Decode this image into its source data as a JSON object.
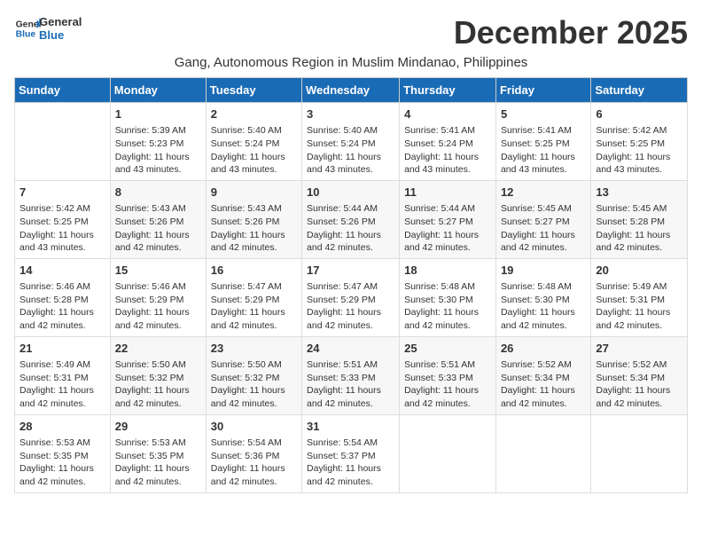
{
  "header": {
    "logo_line1": "General",
    "logo_line2": "Blue",
    "month_title": "December 2025",
    "subtitle": "Gang, Autonomous Region in Muslim Mindanao, Philippines"
  },
  "days_of_week": [
    "Sunday",
    "Monday",
    "Tuesday",
    "Wednesday",
    "Thursday",
    "Friday",
    "Saturday"
  ],
  "weeks": [
    [
      {
        "day": "",
        "info": ""
      },
      {
        "day": "1",
        "info": "Sunrise: 5:39 AM\nSunset: 5:23 PM\nDaylight: 11 hours\nand 43 minutes."
      },
      {
        "day": "2",
        "info": "Sunrise: 5:40 AM\nSunset: 5:24 PM\nDaylight: 11 hours\nand 43 minutes."
      },
      {
        "day": "3",
        "info": "Sunrise: 5:40 AM\nSunset: 5:24 PM\nDaylight: 11 hours\nand 43 minutes."
      },
      {
        "day": "4",
        "info": "Sunrise: 5:41 AM\nSunset: 5:24 PM\nDaylight: 11 hours\nand 43 minutes."
      },
      {
        "day": "5",
        "info": "Sunrise: 5:41 AM\nSunset: 5:25 PM\nDaylight: 11 hours\nand 43 minutes."
      },
      {
        "day": "6",
        "info": "Sunrise: 5:42 AM\nSunset: 5:25 PM\nDaylight: 11 hours\nand 43 minutes."
      }
    ],
    [
      {
        "day": "7",
        "info": "Sunrise: 5:42 AM\nSunset: 5:25 PM\nDaylight: 11 hours\nand 43 minutes."
      },
      {
        "day": "8",
        "info": "Sunrise: 5:43 AM\nSunset: 5:26 PM\nDaylight: 11 hours\nand 42 minutes."
      },
      {
        "day": "9",
        "info": "Sunrise: 5:43 AM\nSunset: 5:26 PM\nDaylight: 11 hours\nand 42 minutes."
      },
      {
        "day": "10",
        "info": "Sunrise: 5:44 AM\nSunset: 5:26 PM\nDaylight: 11 hours\nand 42 minutes."
      },
      {
        "day": "11",
        "info": "Sunrise: 5:44 AM\nSunset: 5:27 PM\nDaylight: 11 hours\nand 42 minutes."
      },
      {
        "day": "12",
        "info": "Sunrise: 5:45 AM\nSunset: 5:27 PM\nDaylight: 11 hours\nand 42 minutes."
      },
      {
        "day": "13",
        "info": "Sunrise: 5:45 AM\nSunset: 5:28 PM\nDaylight: 11 hours\nand 42 minutes."
      }
    ],
    [
      {
        "day": "14",
        "info": "Sunrise: 5:46 AM\nSunset: 5:28 PM\nDaylight: 11 hours\nand 42 minutes."
      },
      {
        "day": "15",
        "info": "Sunrise: 5:46 AM\nSunset: 5:29 PM\nDaylight: 11 hours\nand 42 minutes."
      },
      {
        "day": "16",
        "info": "Sunrise: 5:47 AM\nSunset: 5:29 PM\nDaylight: 11 hours\nand 42 minutes."
      },
      {
        "day": "17",
        "info": "Sunrise: 5:47 AM\nSunset: 5:29 PM\nDaylight: 11 hours\nand 42 minutes."
      },
      {
        "day": "18",
        "info": "Sunrise: 5:48 AM\nSunset: 5:30 PM\nDaylight: 11 hours\nand 42 minutes."
      },
      {
        "day": "19",
        "info": "Sunrise: 5:48 AM\nSunset: 5:30 PM\nDaylight: 11 hours\nand 42 minutes."
      },
      {
        "day": "20",
        "info": "Sunrise: 5:49 AM\nSunset: 5:31 PM\nDaylight: 11 hours\nand 42 minutes."
      }
    ],
    [
      {
        "day": "21",
        "info": "Sunrise: 5:49 AM\nSunset: 5:31 PM\nDaylight: 11 hours\nand 42 minutes."
      },
      {
        "day": "22",
        "info": "Sunrise: 5:50 AM\nSunset: 5:32 PM\nDaylight: 11 hours\nand 42 minutes."
      },
      {
        "day": "23",
        "info": "Sunrise: 5:50 AM\nSunset: 5:32 PM\nDaylight: 11 hours\nand 42 minutes."
      },
      {
        "day": "24",
        "info": "Sunrise: 5:51 AM\nSunset: 5:33 PM\nDaylight: 11 hours\nand 42 minutes."
      },
      {
        "day": "25",
        "info": "Sunrise: 5:51 AM\nSunset: 5:33 PM\nDaylight: 11 hours\nand 42 minutes."
      },
      {
        "day": "26",
        "info": "Sunrise: 5:52 AM\nSunset: 5:34 PM\nDaylight: 11 hours\nand 42 minutes."
      },
      {
        "day": "27",
        "info": "Sunrise: 5:52 AM\nSunset: 5:34 PM\nDaylight: 11 hours\nand 42 minutes."
      }
    ],
    [
      {
        "day": "28",
        "info": "Sunrise: 5:53 AM\nSunset: 5:35 PM\nDaylight: 11 hours\nand 42 minutes."
      },
      {
        "day": "29",
        "info": "Sunrise: 5:53 AM\nSunset: 5:35 PM\nDaylight: 11 hours\nand 42 minutes."
      },
      {
        "day": "30",
        "info": "Sunrise: 5:54 AM\nSunset: 5:36 PM\nDaylight: 11 hours\nand 42 minutes."
      },
      {
        "day": "31",
        "info": "Sunrise: 5:54 AM\nSunset: 5:37 PM\nDaylight: 11 hours\nand 42 minutes."
      },
      {
        "day": "",
        "info": ""
      },
      {
        "day": "",
        "info": ""
      },
      {
        "day": "",
        "info": ""
      }
    ]
  ]
}
